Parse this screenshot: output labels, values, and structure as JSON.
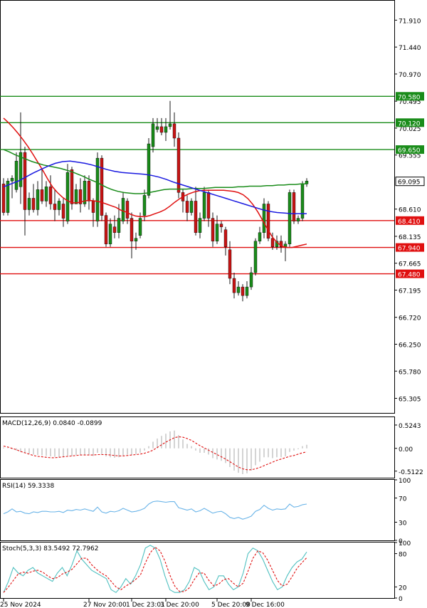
{
  "chart_data": {
    "type": "candlestick",
    "price_axis": {
      "labels": [
        "71.910",
        "71.440",
        "70.970",
        "70.495",
        "70.025",
        "69.555",
        "68.610",
        "68.135",
        "67.665",
        "67.195",
        "66.720",
        "66.250",
        "65.780",
        "65.305"
      ],
      "values": [
        71.91,
        71.44,
        70.97,
        70.495,
        70.025,
        69.555,
        68.61,
        68.135,
        67.665,
        67.195,
        66.72,
        66.25,
        65.78,
        65.305
      ],
      "range": [
        65.05,
        72.25
      ]
    },
    "current_price": {
      "label": "69.095",
      "value": 69.095
    },
    "levels": [
      {
        "label": "70.580",
        "value": 70.58,
        "color": "#1a8c1a"
      },
      {
        "label": "70.120",
        "value": 70.12,
        "color": "#1a8c1a"
      },
      {
        "label": "69.650",
        "value": 69.65,
        "color": "#1a8c1a"
      },
      {
        "label": "68.410",
        "value": 68.41,
        "color": "#e01010"
      },
      {
        "label": "67.940",
        "value": 67.94,
        "color": "#e01010"
      },
      {
        "label": "67.480",
        "value": 67.48,
        "color": "#e01010"
      }
    ],
    "candles": [
      [
        69.05,
        68.55,
        69.15,
        68.5
      ],
      [
        68.55,
        69.1,
        69.15,
        68.5
      ],
      [
        69.1,
        69.15,
        69.2,
        68.8
      ],
      [
        68.95,
        69.45,
        69.6,
        68.9
      ],
      [
        69.0,
        69.6,
        70.3,
        68.7
      ],
      [
        69.6,
        68.6,
        69.7,
        68.15
      ],
      [
        68.6,
        68.8,
        68.9,
        68.5
      ],
      [
        68.8,
        68.6,
        69.05,
        68.55
      ],
      [
        68.6,
        68.95,
        69.1,
        68.5
      ],
      [
        68.95,
        68.75,
        69.3,
        68.7
      ],
      [
        68.75,
        69.0,
        69.1,
        68.65
      ],
      [
        69.0,
        68.7,
        69.2,
        68.6
      ],
      [
        68.7,
        68.6,
        68.95,
        68.4
      ],
      [
        68.6,
        68.75,
        68.8,
        68.5
      ],
      [
        68.7,
        68.45,
        68.8,
        68.3
      ],
      [
        68.4,
        69.25,
        69.4,
        68.35
      ],
      [
        69.3,
        68.7,
        69.35,
        68.6
      ],
      [
        68.7,
        68.95,
        69.05,
        68.7
      ],
      [
        68.95,
        68.7,
        69.15,
        68.55
      ],
      [
        68.7,
        69.1,
        69.2,
        68.65
      ],
      [
        69.1,
        68.75,
        69.2,
        68.6
      ],
      [
        68.75,
        68.55,
        68.8,
        68.3
      ],
      [
        68.4,
        69.5,
        69.6,
        68.3
      ],
      [
        69.5,
        68.5,
        69.55,
        68.4
      ],
      [
        68.5,
        68.0,
        68.55,
        67.95
      ],
      [
        68.0,
        68.35,
        68.45,
        67.95
      ],
      [
        68.3,
        68.2,
        68.5,
        68.1
      ],
      [
        68.2,
        68.45,
        68.7,
        68.1
      ],
      [
        68.4,
        68.8,
        68.9,
        68.35
      ],
      [
        68.75,
        68.45,
        68.8,
        68.35
      ],
      [
        68.45,
        68.05,
        68.55,
        67.75
      ],
      [
        68.05,
        68.1,
        68.2,
        67.9
      ],
      [
        68.15,
        68.45,
        68.55,
        68.1
      ],
      [
        68.5,
        68.85,
        68.95,
        68.4
      ],
      [
        68.85,
        69.75,
        69.85,
        68.8
      ],
      [
        69.7,
        70.1,
        70.2,
        69.6
      ],
      [
        70.0,
        70.05,
        70.2,
        69.95
      ],
      [
        70.05,
        69.95,
        70.2,
        69.9
      ],
      [
        69.95,
        70.05,
        70.2,
        69.8
      ],
      [
        70.05,
        70.1,
        70.5,
        70.0
      ],
      [
        70.1,
        69.85,
        70.3,
        69.7
      ],
      [
        69.85,
        68.9,
        69.95,
        68.8
      ],
      [
        68.9,
        68.75,
        68.95,
        68.55
      ],
      [
        68.75,
        68.55,
        68.85,
        68.4
      ],
      [
        68.55,
        68.75,
        68.8,
        68.5
      ],
      [
        68.75,
        68.2,
        69.0,
        68.15
      ],
      [
        68.2,
        68.45,
        68.55,
        68.1
      ],
      [
        68.45,
        68.9,
        69.0,
        68.4
      ],
      [
        68.9,
        68.45,
        68.95,
        68.3
      ],
      [
        68.45,
        68.05,
        68.55,
        67.95
      ],
      [
        68.05,
        68.35,
        68.5,
        68.0
      ],
      [
        68.35,
        68.3,
        68.4,
        68.2
      ],
      [
        68.25,
        67.95,
        68.3,
        67.8
      ],
      [
        67.9,
        67.4,
        68.05,
        67.3
      ],
      [
        67.4,
        67.15,
        67.5,
        67.05
      ],
      [
        67.15,
        67.25,
        67.35,
        67.1
      ],
      [
        67.25,
        67.1,
        67.3,
        67.0
      ],
      [
        67.1,
        67.25,
        67.35,
        67.05
      ],
      [
        67.25,
        67.5,
        67.6,
        67.2
      ],
      [
        67.5,
        68.05,
        68.1,
        67.45
      ],
      [
        68.05,
        68.2,
        68.3,
        68.0
      ],
      [
        68.2,
        68.7,
        68.8,
        68.1
      ],
      [
        68.7,
        68.1,
        68.75,
        68.05
      ],
      [
        68.1,
        67.95,
        68.2,
        67.9
      ],
      [
        67.95,
        68.05,
        68.15,
        67.9
      ],
      [
        68.05,
        67.95,
        68.15,
        67.85
      ],
      [
        67.95,
        68.0,
        68.05,
        67.7
      ],
      [
        68.0,
        68.9,
        68.95,
        67.95
      ],
      [
        68.9,
        68.4,
        68.95,
        68.35
      ],
      [
        68.4,
        68.45,
        68.5,
        68.35
      ],
      [
        68.45,
        69.05,
        69.1,
        68.4
      ],
      [
        69.05,
        69.1,
        69.15,
        69.0
      ]
    ],
    "moving_averages": [
      {
        "color": "#e01010",
        "values": [
          70.2,
          70.12,
          70.03,
          69.93,
          69.82,
          69.7,
          69.57,
          69.43,
          69.29,
          69.14,
          69.0,
          68.9,
          68.82,
          68.76,
          68.72,
          68.72,
          68.74,
          68.76,
          68.76,
          68.75,
          68.73,
          68.7,
          68.67,
          68.64,
          68.59,
          68.56,
          68.52,
          68.49,
          68.48,
          68.48,
          68.5,
          68.53,
          68.56,
          68.6,
          68.66,
          68.73,
          68.79,
          68.84,
          68.88,
          68.91,
          68.93,
          68.94,
          68.94,
          68.94,
          68.94,
          68.94,
          68.93,
          68.92,
          68.9,
          68.86,
          68.79,
          68.69,
          68.56,
          68.41,
          68.26,
          68.12,
          68.02,
          67.96,
          67.94,
          67.94,
          67.96,
          67.98,
          68.0
        ]
      },
      {
        "color": "#1a8c1a",
        "values": [
          69.65,
          69.61,
          69.56,
          69.52,
          69.48,
          69.44,
          69.41,
          69.38,
          69.36,
          69.34,
          69.32,
          69.29,
          69.26,
          69.22,
          69.18,
          69.13,
          69.09,
          69.04,
          68.99,
          68.95,
          68.92,
          68.9,
          68.89,
          68.88,
          68.88,
          68.89,
          68.91,
          68.93,
          68.95,
          68.96,
          68.96,
          68.96,
          68.96,
          68.97,
          68.97,
          68.97,
          68.98,
          68.99,
          68.99,
          68.99,
          68.99,
          69.0,
          69.0,
          69.01,
          69.01,
          69.01,
          69.02,
          69.02,
          69.03,
          69.03,
          69.04,
          69.04,
          69.05,
          69.05
        ]
      },
      {
        "color": "#1a1ae0",
        "values": [
          69.0,
          69.05,
          69.1,
          69.17,
          69.24,
          69.3,
          69.36,
          69.41,
          69.44,
          69.45,
          69.43,
          69.41,
          69.38,
          69.34,
          69.3,
          69.27,
          69.25,
          69.24,
          69.23,
          69.22,
          69.2,
          69.17,
          69.13,
          69.08,
          69.04,
          69.0,
          68.96,
          68.92,
          68.88,
          68.84,
          68.8,
          68.76,
          68.72,
          68.68,
          68.64,
          68.6,
          68.57,
          68.55,
          68.54,
          68.53,
          68.53,
          68.53
        ]
      }
    ],
    "macd": {
      "label": "MACD(12,26,9) 0.0840 -0.0899",
      "axis_labels": [
        "0.5243",
        "0.00",
        "-0.5122"
      ],
      "axis_values": [
        0.5243,
        0.0,
        -0.5122
      ],
      "range": [
        -0.66,
        0.7
      ],
      "histogram": [
        0.02,
        0.01,
        -0.02,
        -0.05,
        -0.08,
        -0.1,
        -0.12,
        -0.14,
        -0.15,
        -0.16,
        -0.17,
        -0.18,
        -0.19,
        -0.2,
        -0.2,
        -0.17,
        -0.17,
        -0.15,
        -0.16,
        -0.14,
        -0.15,
        -0.17,
        -0.1,
        -0.13,
        -0.18,
        -0.2,
        -0.21,
        -0.2,
        -0.16,
        -0.14,
        -0.15,
        -0.13,
        -0.1,
        -0.05,
        0.05,
        0.15,
        0.22,
        0.28,
        0.33,
        0.38,
        0.4,
        0.3,
        0.2,
        0.1,
        0.05,
        -0.05,
        -0.1,
        -0.1,
        -0.14,
        -0.22,
        -0.25,
        -0.28,
        -0.33,
        -0.42,
        -0.5,
        -0.55,
        -0.58,
        -0.56,
        -0.5,
        -0.38,
        -0.3,
        -0.2,
        -0.2,
        -0.22,
        -0.2,
        -0.2,
        -0.18,
        -0.08,
        -0.05,
        -0.02,
        0.05,
        0.08
      ],
      "signal": [
        0.05,
        0.03,
        0.0,
        -0.03,
        -0.07,
        -0.1,
        -0.13,
        -0.16,
        -0.18,
        -0.19,
        -0.2,
        -0.21,
        -0.21,
        -0.2,
        -0.19,
        -0.18,
        -0.17,
        -0.16,
        -0.15,
        -0.15,
        -0.15,
        -0.15,
        -0.14,
        -0.14,
        -0.14,
        -0.15,
        -0.16,
        -0.17,
        -0.17,
        -0.16,
        -0.15,
        -0.14,
        -0.13,
        -0.11,
        -0.08,
        -0.04,
        0.02,
        0.08,
        0.14,
        0.19,
        0.24,
        0.26,
        0.25,
        0.22,
        0.18,
        0.12,
        0.06,
        0.01,
        -0.04,
        -0.09,
        -0.14,
        -0.19,
        -0.24,
        -0.3,
        -0.36,
        -0.42,
        -0.46,
        -0.48,
        -0.48,
        -0.46,
        -0.43,
        -0.39,
        -0.35,
        -0.31,
        -0.27,
        -0.24,
        -0.21,
        -0.18,
        -0.16,
        -0.13,
        -0.1,
        -0.08
      ]
    },
    "rsi": {
      "label": "RSI(14) 59.3338",
      "axis_labels": [
        "100",
        "70",
        "30",
        "0"
      ],
      "axis_values": [
        100,
        70,
        30,
        0
      ],
      "range": [
        0,
        100
      ],
      "values": [
        44,
        47,
        52,
        47,
        48,
        45,
        44,
        47,
        46,
        48,
        48,
        47,
        47,
        48,
        46,
        50,
        49,
        51,
        50,
        52,
        50,
        48,
        55,
        47,
        45,
        48,
        47,
        49,
        53,
        50,
        47,
        48,
        50,
        53,
        60,
        64,
        65,
        64,
        63,
        64,
        64,
        54,
        52,
        50,
        52,
        47,
        49,
        53,
        49,
        45,
        47,
        48,
        44,
        38,
        36,
        38,
        35,
        37,
        40,
        48,
        51,
        58,
        53,
        50,
        52,
        51,
        52,
        60,
        55,
        56,
        59,
        60
      ]
    },
    "stoch": {
      "label": "Stoch(5,3,3) 83.5492 72.7962",
      "axis_labels": [
        "100",
        "80",
        "20",
        "0"
      ],
      "axis_values": [
        100,
        80,
        20,
        0
      ],
      "range": [
        0,
        100
      ],
      "k": [
        10,
        30,
        55,
        45,
        40,
        50,
        55,
        45,
        40,
        35,
        30,
        45,
        55,
        40,
        60,
        85,
        70,
        60,
        50,
        45,
        40,
        35,
        15,
        10,
        20,
        35,
        25,
        40,
        60,
        90,
        95,
        90,
        70,
        40,
        15,
        10,
        10,
        15,
        30,
        55,
        50,
        30,
        15,
        20,
        40,
        40,
        25,
        15,
        20,
        45,
        80,
        90,
        85,
        70,
        50,
        30,
        15,
        20,
        40,
        55,
        65,
        70,
        83
      ]
    },
    "time_axis": {
      "labels": [
        "25 Nov 2024",
        "27 Nov 20:00",
        "1 Dec 23:01",
        "3 Dec 20:00",
        "5 Dec 20:00",
        "9 Dec 16:00"
      ],
      "positions": [
        0,
        20,
        30,
        38,
        50,
        58
      ]
    }
  }
}
